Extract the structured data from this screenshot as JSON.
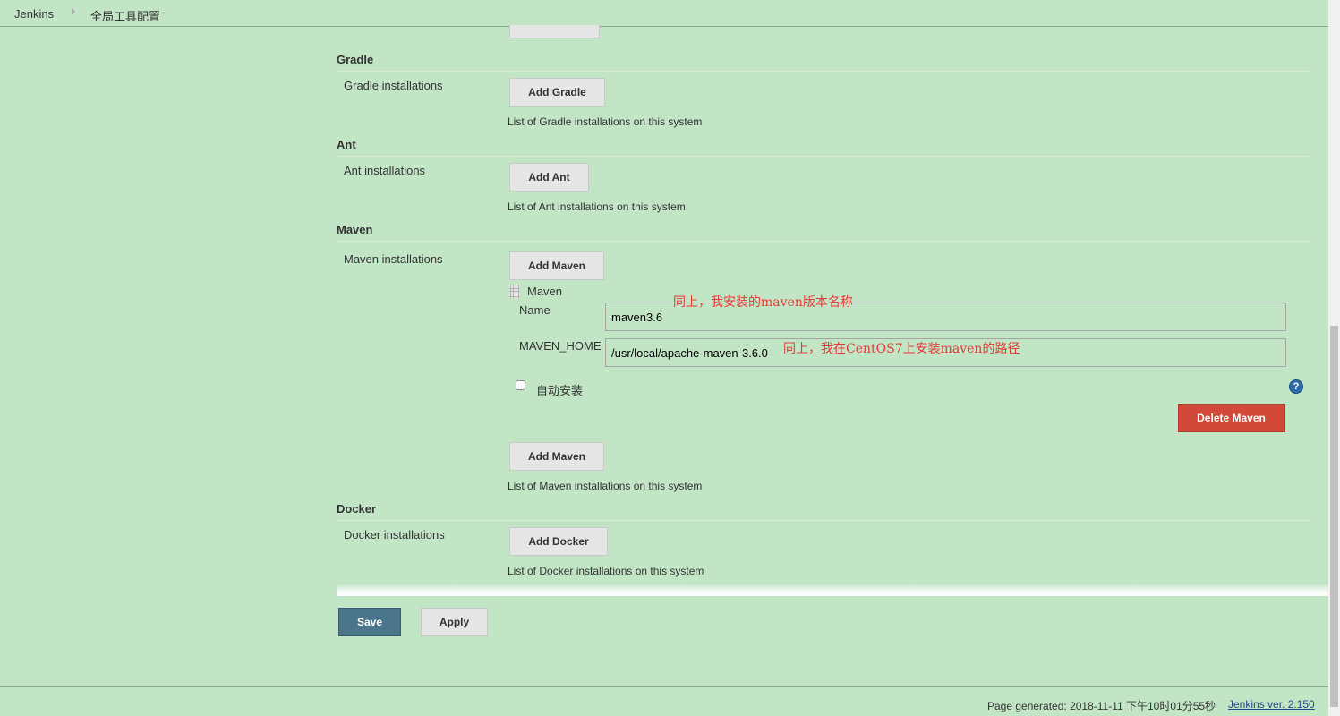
{
  "breadcrumb": {
    "items": [
      "Jenkins",
      "全局工具配置"
    ]
  },
  "sections": {
    "gradle": {
      "title": "Gradle",
      "label": "Gradle installations",
      "add_button": "Add Gradle",
      "help": "List of Gradle installations on this system"
    },
    "ant": {
      "title": "Ant",
      "label": "Ant installations",
      "add_button": "Add Ant",
      "help": "List of Ant installations on this system"
    },
    "maven": {
      "title": "Maven",
      "label": "Maven installations",
      "add_button": "Add Maven",
      "installation": {
        "header": "Maven",
        "name_label": "Name",
        "name_value": "maven3.6",
        "home_label": "MAVEN_HOME",
        "home_value": "/usr/local/apache-maven-3.6.0",
        "auto_install_label": "自动安装",
        "auto_install_checked": false,
        "delete_button": "Delete Maven"
      },
      "add_button_bottom": "Add Maven",
      "help": "List of Maven installations on this system"
    },
    "docker": {
      "title": "Docker",
      "label": "Docker installations",
      "add_button": "Add Docker",
      "help": "List of Docker installations on this system"
    }
  },
  "annotations": {
    "name_note": "同上，我安装的maven版本名称",
    "home_note": "同上，我在CentOS7上安装maven的路径"
  },
  "actions": {
    "save": "Save",
    "apply": "Apply"
  },
  "footer": {
    "generated": "Page generated: 2018-11-11 下午10时01分55秒",
    "version_link": "Jenkins ver. 2.150"
  },
  "colors": {
    "page_background": "#c2e5c6",
    "save_button": "#4b758b",
    "delete_button": "#d24939",
    "annotation": "#e53935"
  }
}
